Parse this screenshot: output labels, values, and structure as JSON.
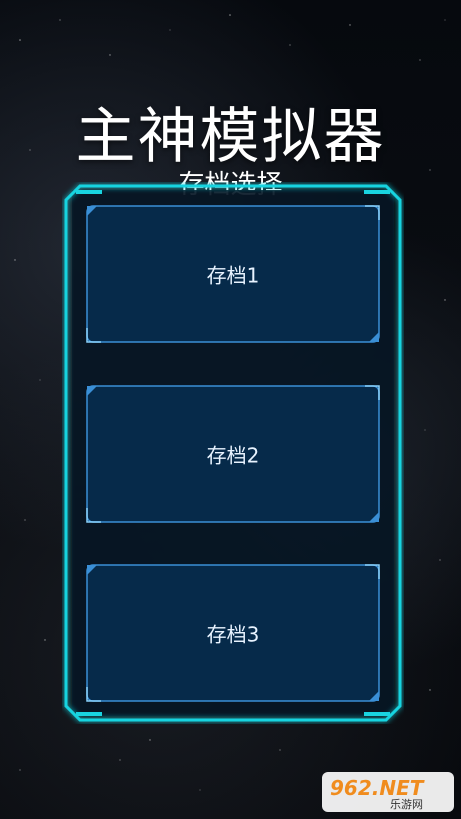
{
  "title": "主神模拟器",
  "subtitle": "存档选择",
  "save_slots": [
    {
      "label": "存档1"
    },
    {
      "label": "存档2"
    },
    {
      "label": "存档3"
    }
  ],
  "watermark": {
    "brand": "962.NET",
    "caption": "乐游网"
  },
  "colors": {
    "frame_accent": "#19d4e0",
    "slot_border": "#3a8fd6",
    "slot_fill": "#062a4a",
    "panel_fill": "#061624"
  }
}
